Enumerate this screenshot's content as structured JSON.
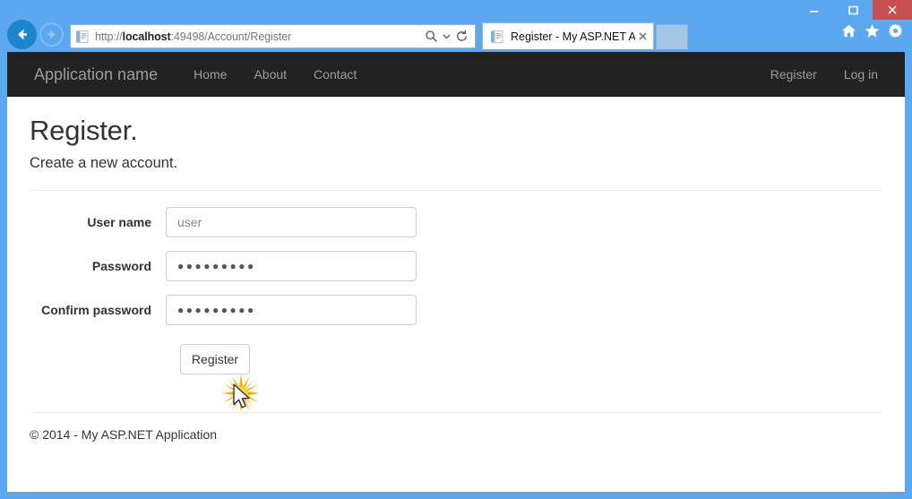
{
  "browser": {
    "window_controls": {
      "minimize_label": "minimize",
      "maximize_label": "maximize",
      "close_label": "close",
      "close_bg": "#C75050"
    },
    "back_label": "Back",
    "forward_label": "Forward",
    "address": {
      "url_prefix": "http://",
      "url_host": "localhost",
      "url_rest": ":49498/Account/Register",
      "url_full": "http://localhost:49498/Account/Register",
      "search_icon": "search-icon",
      "dropdown_icon": "chevron-down-icon",
      "refresh_icon": "refresh-icon"
    },
    "tab": {
      "title": "Register - My ASP.NET App…",
      "close_icon": "close-icon",
      "favicon": "page-icon"
    },
    "new_tab_label": "New tab",
    "command_icons": [
      "home-icon",
      "favorites-star-icon",
      "settings-gear-icon"
    ]
  },
  "navbar": {
    "brand": "Application name",
    "left_items": [
      {
        "label": "Home"
      },
      {
        "label": "About"
      },
      {
        "label": "Contact"
      }
    ],
    "right_items": [
      {
        "label": "Register"
      },
      {
        "label": "Log in"
      }
    ],
    "bg": "#222222",
    "link_color": "#9D9D9D"
  },
  "page": {
    "title": "Register.",
    "subtitle": "Create a new account.",
    "form": {
      "fields": [
        {
          "label": "User name",
          "value": "user",
          "type": "text",
          "is_placeholder": true
        },
        {
          "label": "Password",
          "value": "●●●●●●●●●",
          "type": "password",
          "is_placeholder": false
        },
        {
          "label": "Confirm password",
          "value": "●●●●●●●●●",
          "type": "password",
          "is_placeholder": false
        }
      ],
      "submit_label": "Register"
    }
  },
  "footer": {
    "text": "© 2014 - My ASP.NET Application"
  },
  "overlay": {
    "click_burst_color": "#F5B400",
    "cursor": "arrow-cursor"
  }
}
